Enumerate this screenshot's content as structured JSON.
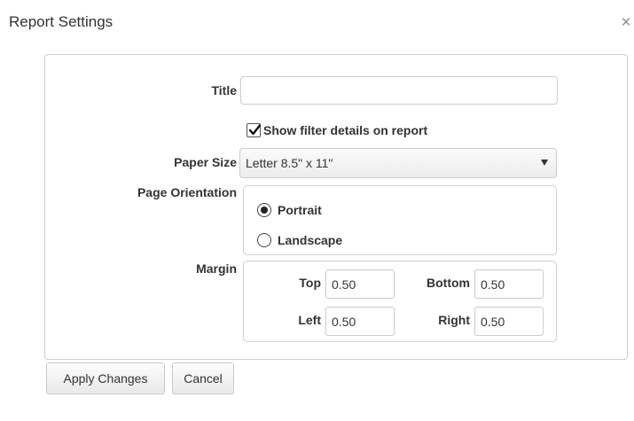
{
  "dialog": {
    "title": "Report Settings",
    "close_glyph": "×"
  },
  "form": {
    "title_label": "Title",
    "title_value": "",
    "show_filter_label": "Show filter details on report",
    "show_filter_checked": true,
    "paper_size_label": "Paper Size",
    "paper_size_value": "Letter 8.5\" x 11\"",
    "orientation_label": "Page Orientation",
    "orientation_options": [
      {
        "label": "Portrait",
        "selected": true
      },
      {
        "label": "Landscape",
        "selected": false
      }
    ],
    "margin_label": "Margin",
    "margins": {
      "top_label": "Top",
      "top_value": "0.50",
      "bottom_label": "Bottom",
      "bottom_value": "0.50",
      "left_label": "Left",
      "left_value": "0.50",
      "right_label": "Right",
      "right_value": "0.50"
    }
  },
  "buttons": {
    "apply_label": "Apply Changes",
    "cancel_label": "Cancel"
  },
  "icons": {
    "close": "close-icon",
    "checkbox": "checkmark-icon",
    "dropdown": "caret-down-icon"
  }
}
